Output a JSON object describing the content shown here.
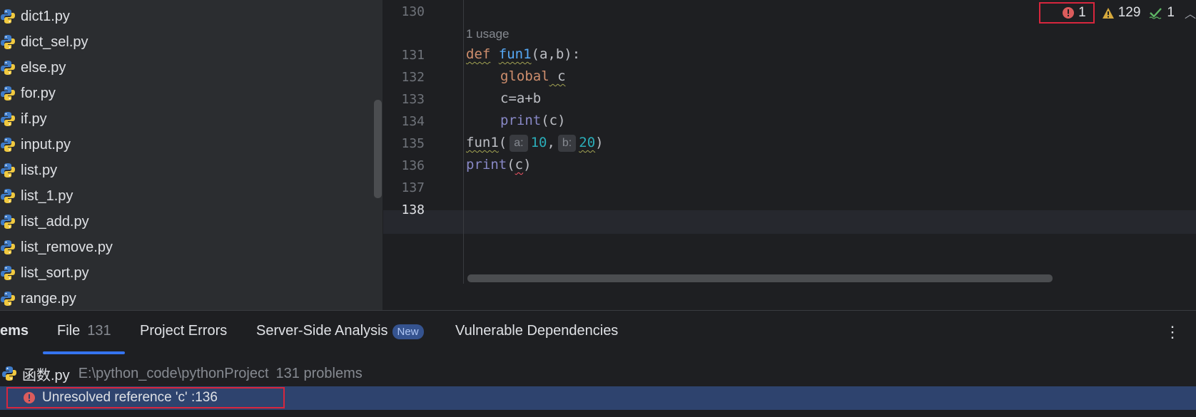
{
  "project_tree": {
    "files": [
      "dict1.py",
      "dict_sel.py",
      "else.py",
      "for.py",
      "if.py",
      "input.py",
      "list.py",
      "list_1.py",
      "list_add.py",
      "list_remove.py",
      "list_sort.py",
      "range.py"
    ],
    "file_icon": "python-file-icon"
  },
  "editor": {
    "line_numbers": [
      "130",
      "131",
      "132",
      "133",
      "134",
      "135",
      "136",
      "137",
      "138"
    ],
    "usage_hint": "1 usage",
    "code": {
      "l131_kw": "def",
      "l131_fn": "fun1",
      "l131_rest": "(a,b):",
      "l132_kw": "global",
      "l132_rest": " c",
      "l133": "c=a+b",
      "l134_bi": "print",
      "l134_rest": "(c)",
      "l135_fn": "fun1",
      "l135_open": "(",
      "l135_hint_a": "a:",
      "l135_val_a": "10",
      "l135_comma": ",",
      "l135_hint_b": "b:",
      "l135_val_b": "20",
      "l135_close": ")",
      "l136_bi": "print",
      "l136_open": "(",
      "l136_c": "c",
      "l136_close": ")"
    },
    "inspections": {
      "errors": "1",
      "warnings": "129",
      "weak_warnings": "1"
    }
  },
  "problems_panel": {
    "tabs": {
      "problems_partial": "ems",
      "file_label": "File",
      "file_count": "131",
      "project_errors": "Project Errors",
      "server_side": "Server-Side Analysis",
      "server_side_badge": "New",
      "vulnerable": "Vulnerable Dependencies"
    },
    "file_row": {
      "name": "函数.py",
      "path": "E:\\python_code\\pythonProject",
      "count": "131 problems"
    },
    "problem": "Unresolved reference 'c' :136"
  },
  "colors": {
    "error_red": "#db5c5c",
    "warning_yellow": "#d6a93c",
    "ok_green": "#5fb865",
    "selection_blue": "#2e436e",
    "accent_blue": "#3574f0"
  }
}
